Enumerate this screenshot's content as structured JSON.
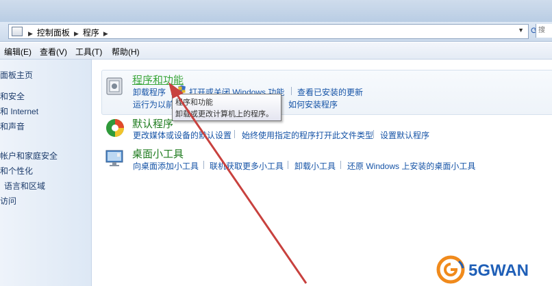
{
  "address": {
    "crumbs": [
      "控制面板",
      "程序"
    ],
    "search_stub": "搜"
  },
  "menu": {
    "items": [
      "编辑(E)",
      "查看(V)",
      "工具(T)",
      "帮助(H)"
    ]
  },
  "sidebar": {
    "items": [
      "面板主页",
      "和安全",
      "和 Internet",
      "和声音",
      "帐户和家庭安全",
      "和个性化",
      "语言和区域",
      "访问"
    ]
  },
  "categories": {
    "programs": {
      "title": "程序和功能",
      "links": [
        "卸载程序",
        "打开或关闭 Windows 功能",
        "查看已安装的更新"
      ],
      "links2": [
        "运行为以前",
        "如何安装程序"
      ]
    },
    "defaults": {
      "title": "默认程序",
      "links": [
        "更改媒体或设备的默认设置",
        "始终使用指定的程序打开此文件类型",
        "设置默认程序"
      ]
    },
    "gadgets": {
      "title": "桌面小工具",
      "links": [
        "向桌面添加小工具",
        "联机获取更多小工具",
        "卸载小工具",
        "还原 Windows 上安装的桌面小工具"
      ]
    }
  },
  "tooltip": {
    "title": "程序和功能",
    "text": "卸载或更改计算机上的程序。"
  },
  "watermark": {
    "text": "5GWAN"
  },
  "colors": {
    "title_green": "#1e7b1e",
    "link_blue": "#1553a6",
    "arrow_red": "#c8413e"
  }
}
